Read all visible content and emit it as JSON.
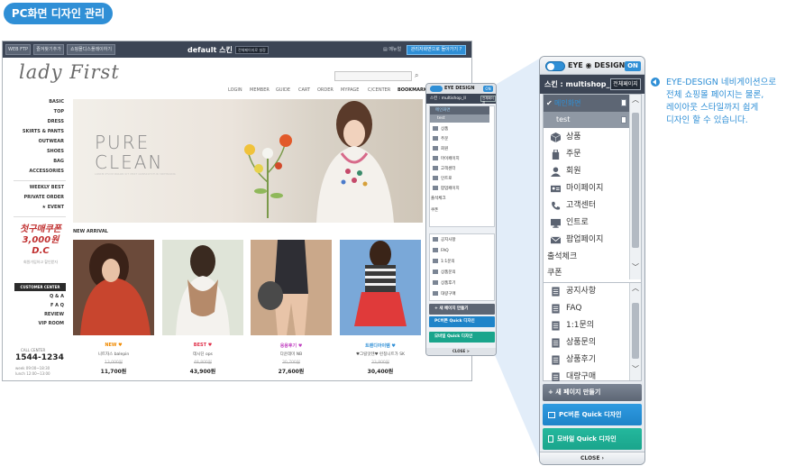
{
  "section_title": "PC화면 디자인 관리",
  "topbar": {
    "btn1": "WEB FTP",
    "btn2": "즐겨찾기추가",
    "btn3": "쇼핑몰디스플레이하기",
    "skin_title": "default 스킨",
    "skin_badge": "전체페이지로 설정",
    "menu": "▤ 메뉴얼",
    "return": "관리자화면으로 돌아가기 ?"
  },
  "shop": {
    "logo": "lady First",
    "topnav": [
      "LOGIN",
      "MEMBER",
      "GUIDE",
      "CART",
      "ORDER",
      "MYPAGE",
      "C/CENTER",
      "BOOKMARK"
    ],
    "categories": [
      "BASIC",
      "TOP",
      "DRESS",
      "SKIRTS & PANTS",
      "OUTWEAR",
      "SHOES",
      "BAG",
      "ACCESSORIES"
    ],
    "specials": [
      "WEEKLY BEST",
      "PRIVATE ORDER",
      "★ EVENT"
    ],
    "coupon_line1": "첫구매쿠폰",
    "coupon_line2": "3,000원 D.C",
    "coupon_small": "회원가입하고 할인받자",
    "customer_center": "CUSTOMER CENTER",
    "cs_links": [
      "Q & A",
      "F A Q",
      "REVIEW",
      "VIP ROOM"
    ],
    "call_label": "CALL CENTER",
    "call_phone": "1544-1234",
    "hours1": "week 09:00~18:30",
    "hours2": "lunch 12:00~13:00",
    "banner_line1": "PURE",
    "banner_line2": "CLEAN",
    "banner_small": "LOREM IPSUM DOLOR SIT AMET CONSECTETUR ADIPISICING",
    "new_arrival": "NEW ARRIVAL",
    "products": [
      {
        "tag": "NEW ♥",
        "tag_color": "#f08a00",
        "name": "니트자스 balepin",
        "orig": "13,000원",
        "price": "11,700원"
      },
      {
        "tag": "BEST ♥",
        "tag_color": "#e0304a",
        "name": "데시딘 ops",
        "orig": "48,800원",
        "price": "43,900원"
      },
      {
        "tag": "응용후기 ♥",
        "tag_color": "#c040c0",
        "name": "다운데미 NB",
        "orig": "30,700원",
        "price": "27,600원"
      },
      {
        "tag": "트렌디아이템 ♥",
        "tag_color": "#2f8fd6",
        "name": "♥그릴맛텐♥ 런칭니트가 SK",
        "orig": "33,800원",
        "price": "30,400원"
      }
    ]
  },
  "mini_panel": {
    "logo": "EYE DESIGN",
    "on": "ON",
    "skin": "스킨 : multishop_II",
    "all_pages": "전체페이지",
    "items": [
      "메인화면",
      "test",
      "상품",
      "주문",
      "회원",
      "마이페이지",
      "고객센터",
      "인트로",
      "팝업페이지",
      "출석체크",
      "쿠폰"
    ],
    "items2": [
      "공지사항",
      "FAQ",
      "1:1문의",
      "상품문의",
      "상품후기",
      "대량구매"
    ],
    "new_page": "+ 새 페이지 만들기",
    "pc_btn": "PC버튼 Quick 디자인",
    "mobile_btn": "모바일 Quick 디자인",
    "close": "CLOSE >"
  },
  "panel": {
    "logo": "EYE ◉ DESIGN",
    "on": "ON",
    "skin_label": "스킨 : multishop_II",
    "all_pages": "전체페이지",
    "main": "메인화면",
    "test": "test",
    "items": [
      {
        "label": "상품",
        "icon": "box-icon"
      },
      {
        "label": "주문",
        "icon": "bag-icon"
      },
      {
        "label": "회원",
        "icon": "person-icon"
      },
      {
        "label": "마이페이지",
        "icon": "id-card-icon"
      },
      {
        "label": "고객센터",
        "icon": "phone-icon"
      },
      {
        "label": "인트로",
        "icon": "monitor-icon"
      },
      {
        "label": "팝업페이지",
        "icon": "mail-icon"
      }
    ],
    "flat_items": [
      "출석체크",
      "쿠폰"
    ],
    "items2": [
      "공지사항",
      "FAQ",
      "1:1문의",
      "상품문의",
      "상품후기",
      "대량구매"
    ],
    "new_page": "+ 새 페이지 만들기",
    "pc_btn": "PC버튼 Quick 디자인",
    "mobile_btn": "모바일 Quick 디자인",
    "close": "CLOSE ›"
  },
  "description": {
    "line1": "EYE-DESIGN 네비게이션으로",
    "line2": "전체 쇼핑몰 페이지는 물론,",
    "line3": "레이아웃 스타일까지 쉽게",
    "line4": "디자인 할 수 있습니다."
  },
  "colors": {
    "accent": "#2f8fd6",
    "topbar": "#3c4555",
    "pc_btn": "#1f84c9",
    "mobile_btn": "#1aa58c"
  }
}
